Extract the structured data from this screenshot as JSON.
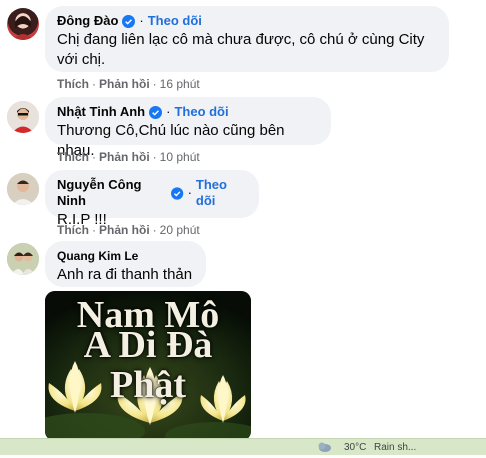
{
  "comments": [
    {
      "author": "Đông Đào",
      "follow": "Theo dõi",
      "text_lines": [
        "Chị đang liên lạc cô mà chưa được, cô chú ở cùng City",
        "với chị."
      ],
      "like": "Thích",
      "reply": "Phản hồi",
      "time": "16 phút",
      "verified": true
    },
    {
      "author": "Nhật Tinh Anh",
      "follow": "Theo dõi",
      "text_lines": [
        "Thương Cô,Chú lúc nào cũng bên nhau."
      ],
      "like": "Thích",
      "reply": "Phản hồi",
      "time": "10 phút",
      "verified": true
    },
    {
      "author": "Nguyễn Công Ninh",
      "follow": "Theo dõi",
      "text_lines": [
        "R.I.P !!!"
      ],
      "like": "Thích",
      "reply": "Phản hồi",
      "time": "20 phút",
      "verified": true
    },
    {
      "author": "Quang Kim Le",
      "text_lines": [
        "Anh ra đi thanh thản"
      ],
      "verified": false
    }
  ],
  "image": {
    "line1": "Nam Mô",
    "line2": "A Di Đà Phật"
  },
  "taskbar": {
    "weather": "30°C",
    "weather_desc": "Rain sh..."
  },
  "colors": {
    "accent": "#216fdb",
    "bubble": "#f0f2f5",
    "meta": "#65676b"
  }
}
